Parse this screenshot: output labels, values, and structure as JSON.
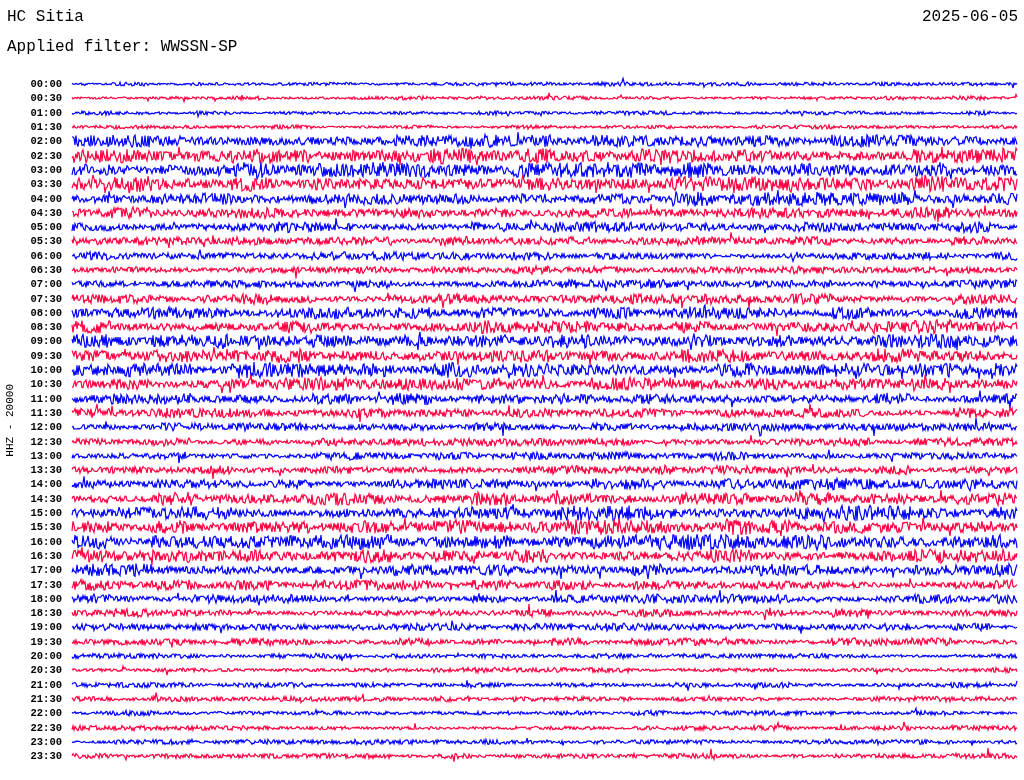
{
  "header": {
    "station": "HC Sitia",
    "date": "2025-06-05",
    "filter": "Applied filter: WWSSN-SP"
  },
  "axis_label": "HHZ - 20000",
  "rows": [
    {
      "time": "00:00",
      "color": "#0000ff"
    },
    {
      "time": "00:30",
      "color": "#ff0040"
    },
    {
      "time": "01:00",
      "color": "#0000ff"
    },
    {
      "time": "01:30",
      "color": "#ff0040"
    },
    {
      "time": "02:00",
      "color": "#0000ff"
    },
    {
      "time": "02:30",
      "color": "#ff0040"
    },
    {
      "time": "03:00",
      "color": "#0000ff"
    },
    {
      "time": "03:30",
      "color": "#ff0040"
    },
    {
      "time": "04:00",
      "color": "#0000ff"
    },
    {
      "time": "04:30",
      "color": "#ff0040"
    },
    {
      "time": "05:00",
      "color": "#0000ff"
    },
    {
      "time": "05:30",
      "color": "#ff0040"
    },
    {
      "time": "06:00",
      "color": "#0000ff"
    },
    {
      "time": "06:30",
      "color": "#ff0040"
    },
    {
      "time": "07:00",
      "color": "#0000ff"
    },
    {
      "time": "07:30",
      "color": "#ff0040"
    },
    {
      "time": "08:00",
      "color": "#0000ff"
    },
    {
      "time": "08:30",
      "color": "#ff0040"
    },
    {
      "time": "09:00",
      "color": "#0000ff"
    },
    {
      "time": "09:30",
      "color": "#ff0040"
    },
    {
      "time": "10:00",
      "color": "#0000ff"
    },
    {
      "time": "10:30",
      "color": "#ff0040"
    },
    {
      "time": "11:00",
      "color": "#0000ff"
    },
    {
      "time": "11:30",
      "color": "#ff0040"
    },
    {
      "time": "12:00",
      "color": "#0000ff"
    },
    {
      "time": "12:30",
      "color": "#ff0040"
    },
    {
      "time": "13:00",
      "color": "#0000ff"
    },
    {
      "time": "13:30",
      "color": "#ff0040"
    },
    {
      "time": "14:00",
      "color": "#0000ff"
    },
    {
      "time": "14:30",
      "color": "#ff0040"
    },
    {
      "time": "15:00",
      "color": "#0000ff"
    },
    {
      "time": "15:30",
      "color": "#ff0040"
    },
    {
      "time": "16:00",
      "color": "#0000ff"
    },
    {
      "time": "16:30",
      "color": "#ff0040"
    },
    {
      "time": "17:00",
      "color": "#0000ff"
    },
    {
      "time": "17:30",
      "color": "#ff0040"
    },
    {
      "time": "18:00",
      "color": "#0000ff"
    },
    {
      "time": "18:30",
      "color": "#ff0040"
    },
    {
      "time": "19:00",
      "color": "#0000ff"
    },
    {
      "time": "19:30",
      "color": "#ff0040"
    },
    {
      "time": "20:00",
      "color": "#0000ff"
    },
    {
      "time": "20:30",
      "color": "#ff0040"
    },
    {
      "time": "21:00",
      "color": "#0000ff"
    },
    {
      "time": "21:30",
      "color": "#ff0040"
    },
    {
      "time": "22:00",
      "color": "#0000ff"
    },
    {
      "time": "22:30",
      "color": "#ff0040"
    },
    {
      "time": "23:00",
      "color": "#0000ff"
    },
    {
      "time": "23:30",
      "color": "#ff0040"
    }
  ]
}
